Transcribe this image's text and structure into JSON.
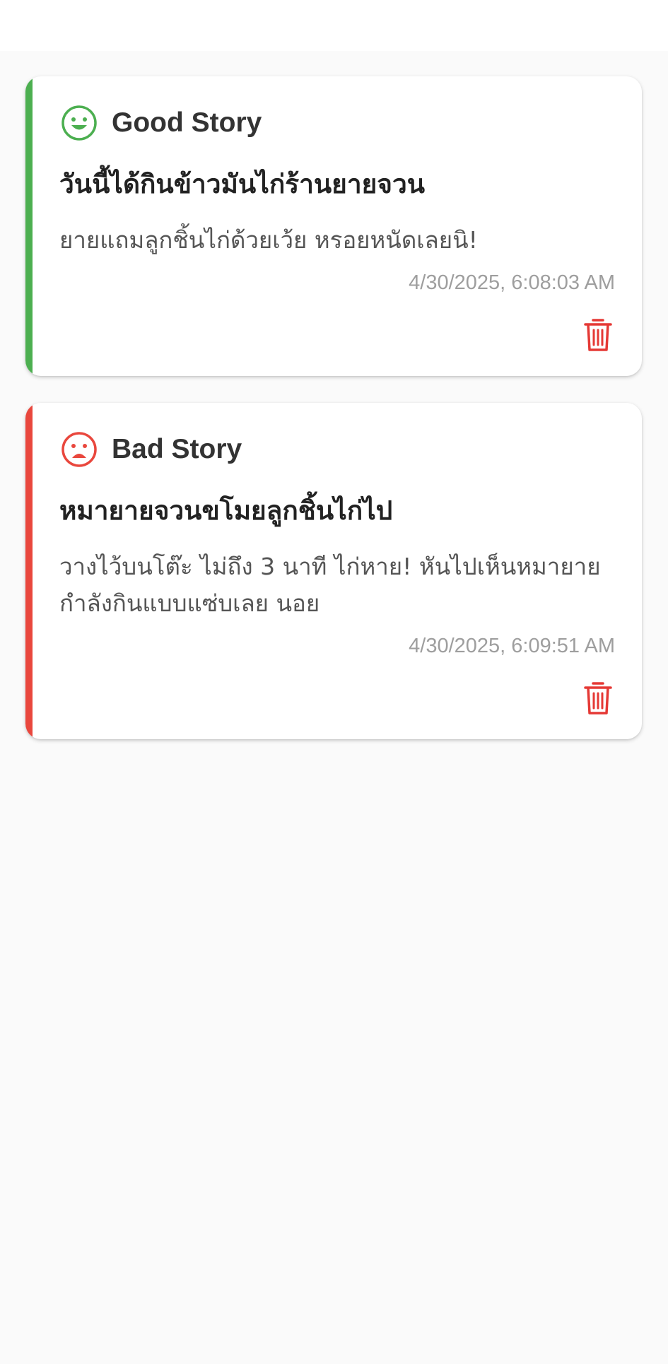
{
  "colors": {
    "good_accent": "#4caf50",
    "bad_accent": "#e9473d",
    "delete": "#e53935"
  },
  "stories": [
    {
      "mood": "good",
      "mood_label": "Good Story",
      "mood_icon": "smile-icon",
      "title": "วันนี้ได้กินข้าวมันไก่ร้านยายจวน",
      "body": "ยายแถมลูกชิ้นไก่ด้วยเว้ย หรอยหนัดเลยนิ!",
      "timestamp": "4/30/2025, 6:08:03 AM"
    },
    {
      "mood": "bad",
      "mood_label": "Bad Story",
      "mood_icon": "sad-icon",
      "title": "หมายายจวนขโมยลูกชิ้นไก่ไป",
      "body": "วางไว้บนโต๊ะ ไม่ถึง 3 นาที ไก่หาย! หันไปเห็นหมายายกำลังกินแบบแซ่บเลย นอย",
      "timestamp": "4/30/2025, 6:09:51 AM"
    }
  ]
}
